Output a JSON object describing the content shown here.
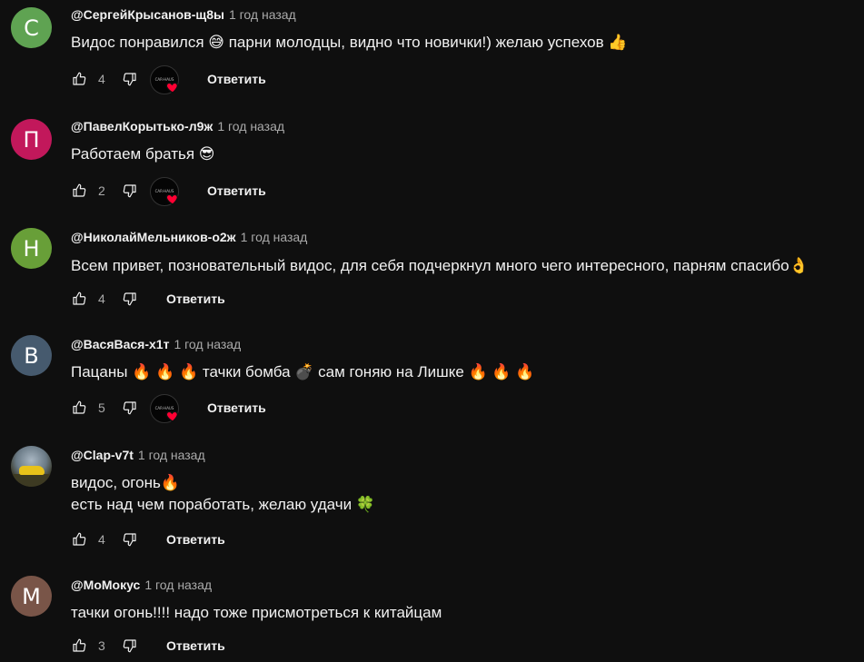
{
  "labels": {
    "reply": "Ответить"
  },
  "colors": {
    "background": "#0f0f0f",
    "text": "#f1f1f1",
    "muted": "#aaaaaa",
    "heart": "#ff0033"
  },
  "comments": [
    {
      "author": "@СергейКрысанов-щ8ы",
      "time": "1 год назад",
      "avatar_letter": "С",
      "avatar_color": "#5fa352",
      "lines": [
        "Видос понравился 😅 парни молодцы, видно что новички!) желаю успехов 👍"
      ],
      "likes": "4",
      "creator_heart": true,
      "creator_badge_text": "CAR-HAUS"
    },
    {
      "author": "@ПавелКорытько-л9ж",
      "time": "1 год назад",
      "avatar_letter": "П",
      "avatar_color": "#c2185b",
      "lines": [
        "Работаем братья 😎"
      ],
      "likes": "2",
      "creator_heart": true,
      "creator_badge_text": "CAR-HAUS"
    },
    {
      "author": "@НиколайМельников-о2ж",
      "time": "1 год назад",
      "avatar_letter": "Н",
      "avatar_color": "#689f38",
      "lines": [
        "Всем привет, позновательный видос, для себя подчеркнул много чего интересного, парням спасибо👌"
      ],
      "likes": "4",
      "creator_heart": false
    },
    {
      "author": "@ВасяВася-х1т",
      "time": "1 год назад",
      "avatar_letter": "В",
      "avatar_color": "#465a6e",
      "lines": [
        "Пацаны 🔥 🔥 🔥 тачки бомба 💣 сам гоняю на Лишке 🔥 🔥 🔥"
      ],
      "likes": "5",
      "creator_heart": true,
      "creator_badge_text": "CAR-HAUS"
    },
    {
      "author": "@Clap-v7t",
      "time": "1 год назад",
      "avatar_letter": "",
      "avatar_color": "#6a7a86",
      "avatar_photo": true,
      "lines": [
        "видос, огонь🔥",
        "есть над чем поработать, желаю удачи 🍀"
      ],
      "likes": "4",
      "creator_heart": false
    },
    {
      "author": "@МоМокус",
      "time": "1 год назад",
      "avatar_letter": "М",
      "avatar_color": "#795548",
      "lines": [
        "тачки огонь!!!! надо тоже присмотреться к китайцам"
      ],
      "likes": "3",
      "creator_heart": false
    }
  ]
}
